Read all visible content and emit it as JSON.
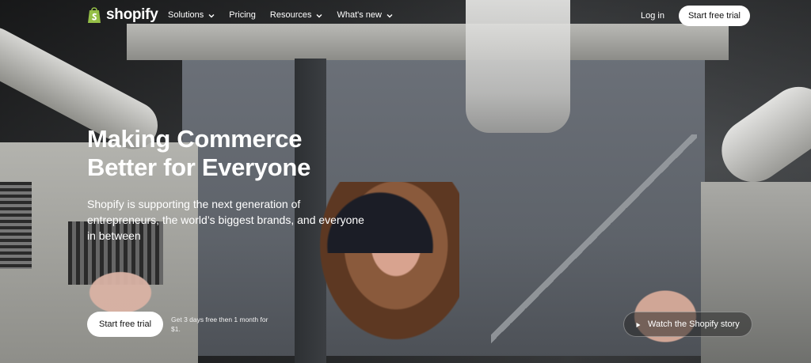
{
  "nav": {
    "brand": "shopify",
    "menu": [
      {
        "label": "Solutions",
        "has_dropdown": true
      },
      {
        "label": "Pricing",
        "has_dropdown": false
      },
      {
        "label": "Resources",
        "has_dropdown": true
      },
      {
        "label": "What's new",
        "has_dropdown": true
      }
    ],
    "login": "Log in",
    "cta": "Start free trial"
  },
  "hero": {
    "title": "Making Commerce Better for Everyone",
    "subtitle": "Shopify is supporting the next generation of entrepreneurs, the world’s biggest brands, and everyone in between",
    "primary_cta": "Start free trial",
    "trial_note": "Get 3 days free then 1 month for $1.",
    "secondary_cta": "Watch the Shopify story"
  },
  "icons": {
    "logo": "shopify-bag-icon",
    "dropdown": "chevron-down-icon",
    "play": "play-icon"
  },
  "colors": {
    "brand_green": "#95BF47",
    "button_bg": "#FFFFFF",
    "text": "#FFFFFF"
  }
}
